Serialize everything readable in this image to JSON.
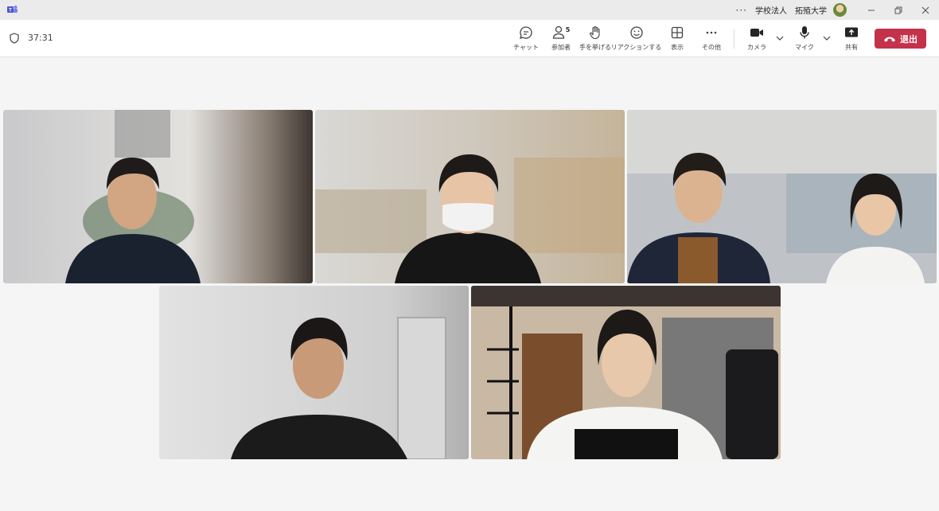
{
  "titlebar": {
    "app_icon": "teams-logo-icon",
    "more": "···",
    "org_name": "学校法人　拓殖大学",
    "controls": [
      "minimize-icon",
      "restore-icon",
      "close-icon"
    ]
  },
  "meeting": {
    "elapsed": "37:31",
    "participant_count": "5"
  },
  "toolbar": {
    "chat": "チャット",
    "participants": "参加者",
    "raise_hand": "手を挙げる",
    "reactions": "リアクションする",
    "view": "表示",
    "more": "その他",
    "camera": "カメラ",
    "mic": "マイク",
    "share": "共有",
    "leave": "退出"
  },
  "colors": {
    "leave": "#c4314b",
    "teams_brand": "#5059c9"
  }
}
